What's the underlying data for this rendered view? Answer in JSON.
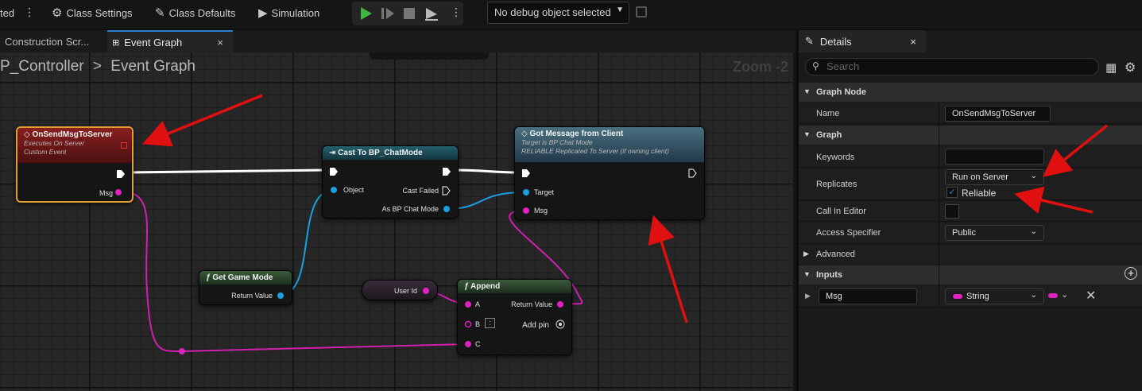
{
  "toolbar": {
    "partial": "ted",
    "class_settings": "Class Settings",
    "class_defaults": "Class Defaults",
    "simulation": "Simulation",
    "debug_select": "No debug object selected"
  },
  "tabs": {
    "construction": "Construction Scr...",
    "event_graph": "Event Graph",
    "close": "×"
  },
  "graph": {
    "crumb_root": "P_Controller",
    "crumb_sep": ">",
    "crumb_page": "Event Graph",
    "zoom": "Zoom -2"
  },
  "nodes": {
    "custom_event": {
      "title": "OnSendMsgToServer",
      "sub1": "Executes On Server",
      "sub2": "Custom Event",
      "pin_msg": "Msg",
      "head_color": "#7a1a1a"
    },
    "cast": {
      "title": "Cast To BP_ChatMode",
      "pin_object": "Object",
      "pin_failed": "Cast Failed",
      "pin_as": "As BP Chat Mode",
      "head_color": "#1d4f5a"
    },
    "got_message": {
      "title": "Got Message from Client",
      "sub1": "Target is BP Chat Mode",
      "sub2": "RELIABLE Replicated To Server (if owning client)",
      "pin_target": "Target",
      "pin_msg": "Msg",
      "head_color": "#3b5a6b"
    },
    "game_mode": {
      "title": "Get Game Mode",
      "pin_ret": "Return Value",
      "head_color": "#2c4a2c"
    },
    "user_id": {
      "title": "User Id"
    },
    "append": {
      "title": "Append",
      "pin_a": "A",
      "pin_b": "B",
      "pin_c": "C",
      "pin_ret": "Return Value",
      "add_pin": "Add pin",
      "b_value": ":",
      "head_color": "#2c4a2c"
    }
  },
  "details": {
    "tab": "Details",
    "close": "×",
    "search_placeholder": "Search",
    "graph_node_section": "Graph Node",
    "name_label": "Name",
    "name_value": "OnSendMsgToServer",
    "graph_section": "Graph",
    "keywords_label": "Keywords",
    "keywords_value": "",
    "replicates_label": "Replicates",
    "replicates_value": "Run on Server",
    "reliable_label": "Reliable",
    "call_in_editor_label": "Call In Editor",
    "access_label": "Access Specifier",
    "access_value": "Public",
    "advanced_section": "Advanced",
    "inputs_section": "Inputs",
    "input_name": "Msg",
    "input_type": "String"
  },
  "colors": {
    "exec": "#ffffff",
    "string_pin": "#e020c0",
    "object_pin": "#1aa0e0",
    "arrow": "#e01010",
    "accent": "#2f7fd1",
    "play": "#3db83d"
  }
}
